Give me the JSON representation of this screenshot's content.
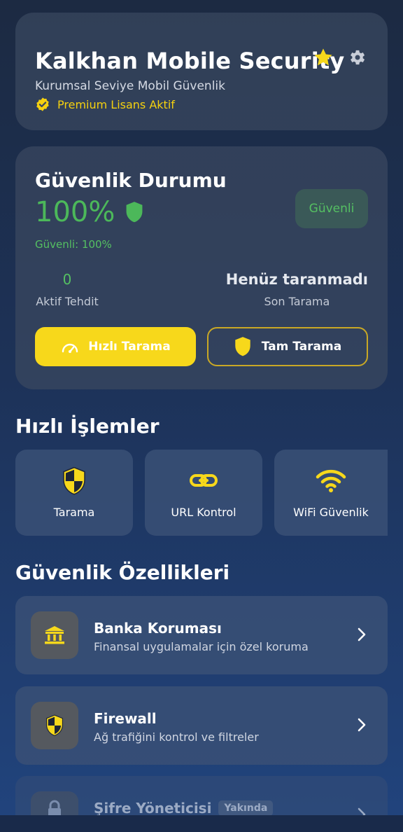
{
  "header": {
    "title": "Kalkhan Mobile Security",
    "subtitle": "Kurumsal Seviye Mobil Güvenlik",
    "license_badge": "Premium Lisans Aktif",
    "star_icon": "star-icon",
    "settings_icon": "gear-icon"
  },
  "status": {
    "title": "Güvenlik Durumu",
    "percent": "100%",
    "chip_label": "Güvenli",
    "safe_line": "Güvenli: 100%",
    "threats_value": "0",
    "threats_label": "Aktif Tehdit",
    "last_scan_value": "Henüz taranmadı",
    "last_scan_label": "Son Tarama",
    "quick_scan_label": "Hızlı Tarama",
    "full_scan_label": "Tam Tarama"
  },
  "quick_actions": {
    "title": "Hızlı İşlemler",
    "items": [
      {
        "label": "Tarama",
        "icon": "shield-icon"
      },
      {
        "label": "URL Kontrol",
        "icon": "link-icon"
      },
      {
        "label": "WiFi Güvenlik",
        "icon": "wifi-icon"
      }
    ]
  },
  "features": {
    "title": "Güvenlik Özellikleri",
    "items": [
      {
        "name": "Banka Koruması",
        "desc": "Finansal uygulamalar için özel koruma",
        "icon": "bank-icon"
      },
      {
        "name": "Firewall",
        "desc": "Ağ trafiğini kontrol ve filtreler",
        "icon": "shield-icon"
      },
      {
        "name": "Şifre Yöneticisi",
        "badge": "Yakında",
        "icon": "lock-icon"
      }
    ]
  },
  "colors": {
    "accent_yellow": "#f7d81b",
    "safe_green": "#4cb85a",
    "card_bg": "#3a4860"
  }
}
